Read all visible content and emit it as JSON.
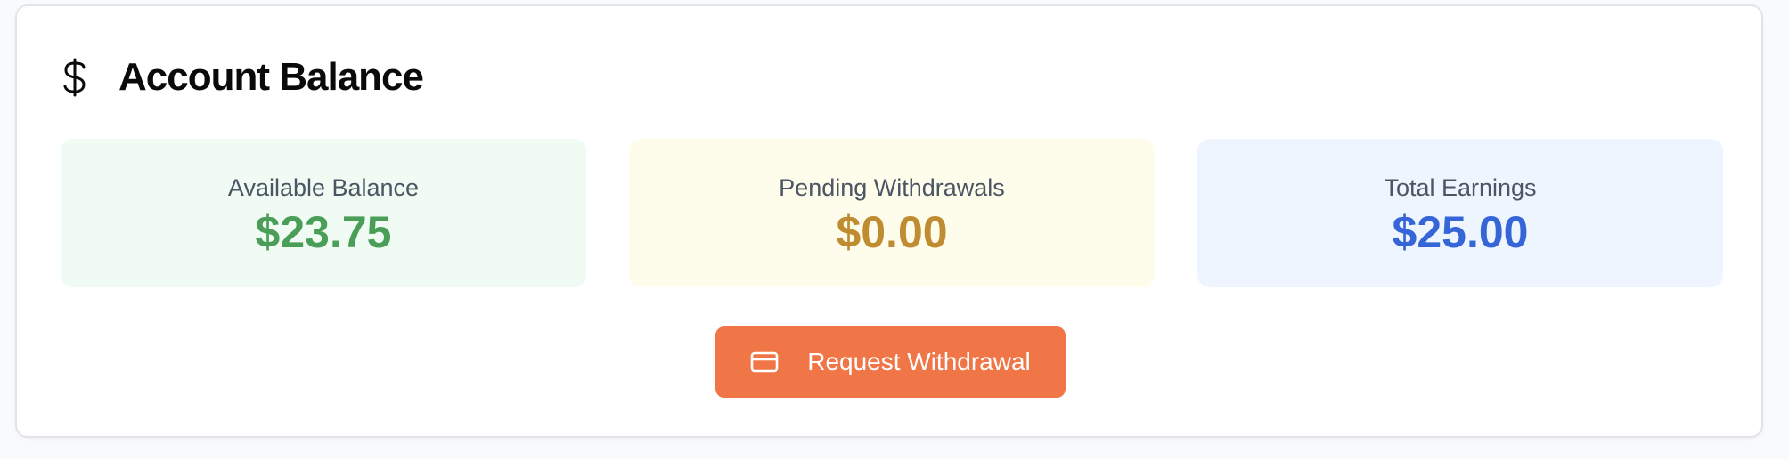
{
  "header": {
    "icon": "dollar-icon",
    "title": "Account Balance"
  },
  "stats": {
    "available": {
      "label": "Available Balance",
      "value": "$23.75",
      "color": "#4a9e57",
      "background": "#f0fbf3"
    },
    "pending": {
      "label": "Pending Withdrawals",
      "value": "$0.00",
      "color": "#c08c31",
      "background": "#fefdeb"
    },
    "total": {
      "label": "Total Earnings",
      "value": "$25.00",
      "color": "#3565d6",
      "background": "#eef5ff"
    }
  },
  "actions": {
    "withdraw": {
      "label": "Request Withdrawal",
      "icon": "credit-card-icon",
      "color": "#f07547"
    }
  }
}
